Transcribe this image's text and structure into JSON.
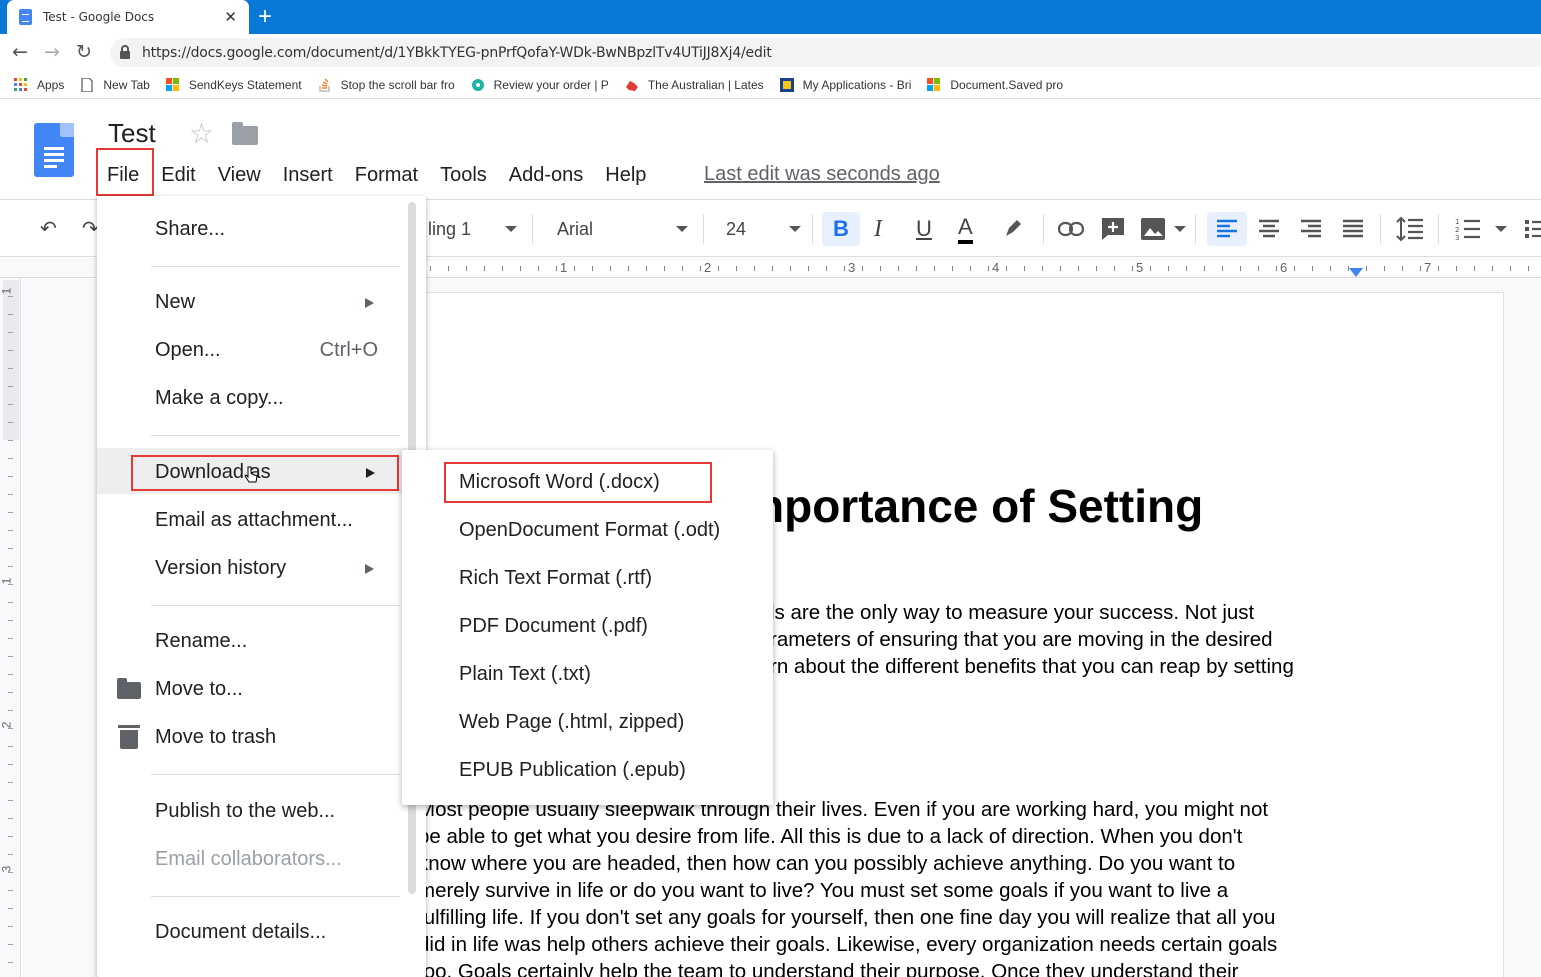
{
  "browser": {
    "tab_title": "Test - Google Docs",
    "tab_close": "✕",
    "new_tab": "+",
    "url": "https://docs.google.com/document/d/1YBkkTYEG-pnPrfQofaY-WDk-BwNBpzlTv4UTiJJ8Xj4/edit",
    "bookmarks": [
      {
        "label": "Apps",
        "icon": "apps-grid-icon"
      },
      {
        "label": "New Tab",
        "icon": "page-icon"
      },
      {
        "label": "SendKeys Statement",
        "icon": "windows-icon"
      },
      {
        "label": "Stop the scroll bar fro",
        "icon": "stackoverflow-icon"
      },
      {
        "label": "Review your order | P",
        "icon": "review-icon"
      },
      {
        "label": "The Australian | Lates",
        "icon": "australian-icon"
      },
      {
        "label": "My Applications - Bri",
        "icon": "applications-icon"
      },
      {
        "label": "Document.Saved pro",
        "icon": "windows-icon"
      }
    ]
  },
  "docs": {
    "title": "Test",
    "menu": [
      "File",
      "Edit",
      "View",
      "Insert",
      "Format",
      "Tools",
      "Add-ons",
      "Help"
    ],
    "last_edit": "Last edit was seconds ago",
    "toolbar": {
      "style": "ling 1",
      "font": "Arial",
      "size": "24",
      "bold": "B",
      "italic": "I",
      "underline": "U",
      "text_color": "A"
    },
    "ruler_numbers": [
      "1",
      "2",
      "3",
      "4",
      "5",
      "6",
      "7"
    ],
    "vruler_numbers": [
      "1",
      "1",
      "2",
      "3"
    ]
  },
  "file_menu": {
    "items": [
      {
        "label": "Share..."
      },
      {
        "label": "New",
        "submenu": true
      },
      {
        "label": "Open...",
        "shortcut": "Ctrl+O"
      },
      {
        "label": "Make a copy..."
      },
      {
        "label": "Download as",
        "submenu": true
      },
      {
        "label": "Email as attachment..."
      },
      {
        "label": "Version history",
        "submenu": true
      },
      {
        "label": "Rename..."
      },
      {
        "label": "Move to..."
      },
      {
        "label": "Move to trash"
      },
      {
        "label": "Publish to the web..."
      },
      {
        "label": "Email collaborators...",
        "disabled": true
      },
      {
        "label": "Document details..."
      }
    ]
  },
  "download_submenu": [
    "Microsoft Word (.docx)",
    "OpenDocument Format (.odt)",
    "Rich Text Format (.rtf)",
    "PDF Document (.pdf)",
    "Plain Text (.txt)",
    "Web Page (.html, zipped)",
    "EPUB Publication (.epub)"
  ],
  "document": {
    "heading": "nportance of Setting",
    "para1": [
      "ls are the only way to measure your success. Not just",
      "rameters of ensuring that you are moving in the desired",
      "rn about the different benefits that you can reap by setting"
    ],
    "para2": [
      "Most people usually sleepwalk through their lives. Even if you are working hard, you might not",
      "be able to get what you desire from life. All this is due to a lack of direction. When you don't",
      "know where you are headed, then how can you possibly achieve anything. Do you want to",
      "merely survive in life or do you want to live? You must set some goals if you want to live a",
      "fulfilling life. If you don't set any goals for yourself, then one fine day you will realize that all you",
      "did in life was help others achieve their goals. Likewise, every organization needs certain goals",
      "too. Goals certainly help the team to understand their purpose. Once they understand their"
    ]
  }
}
